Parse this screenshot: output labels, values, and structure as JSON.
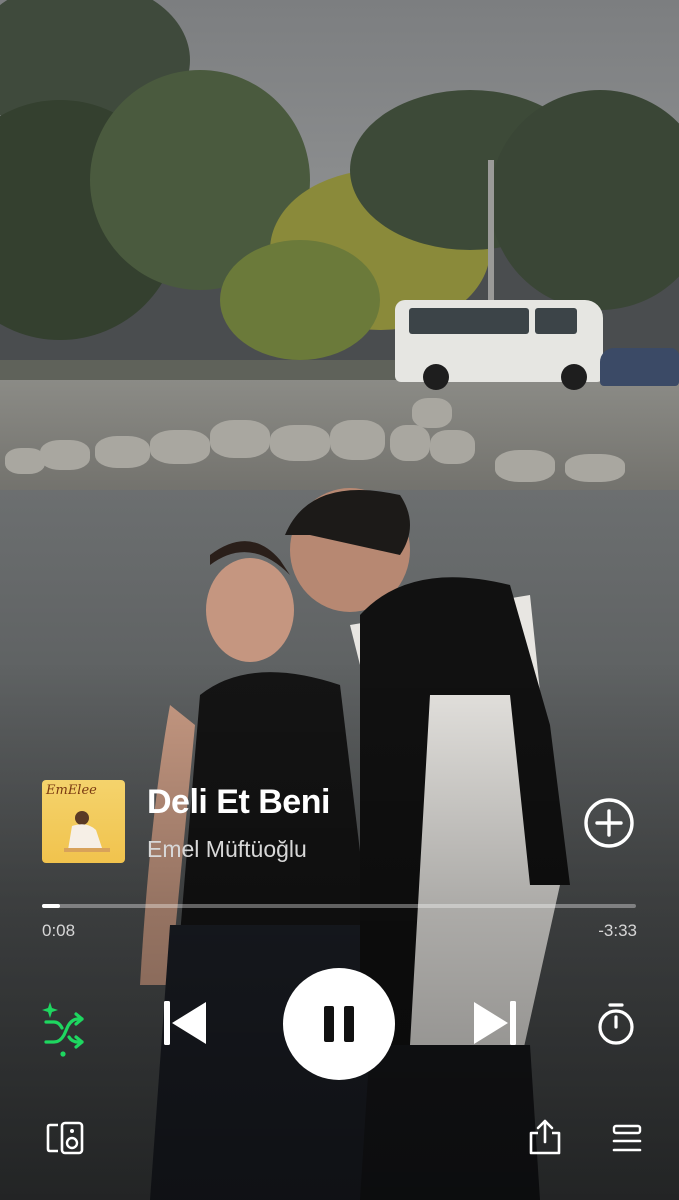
{
  "player": {
    "track_title": "Deli Et Beni",
    "artist": "Emel Müftüoğlu",
    "album_art_text": "EmElee",
    "time_elapsed": "0:08",
    "time_remaining": "-3:33",
    "progress_fraction": 0.03,
    "state": "playing"
  },
  "colors": {
    "accent_green": "#1ed760",
    "control_white": "#ffffff"
  },
  "icons": {
    "add": "plus-circle-icon",
    "shuffle": "smart-shuffle-icon",
    "previous": "skip-previous-icon",
    "pause": "pause-icon",
    "next": "skip-next-icon",
    "sleep_timer": "timer-icon",
    "devices": "connect-devices-icon",
    "share": "share-icon",
    "queue": "queue-icon"
  }
}
